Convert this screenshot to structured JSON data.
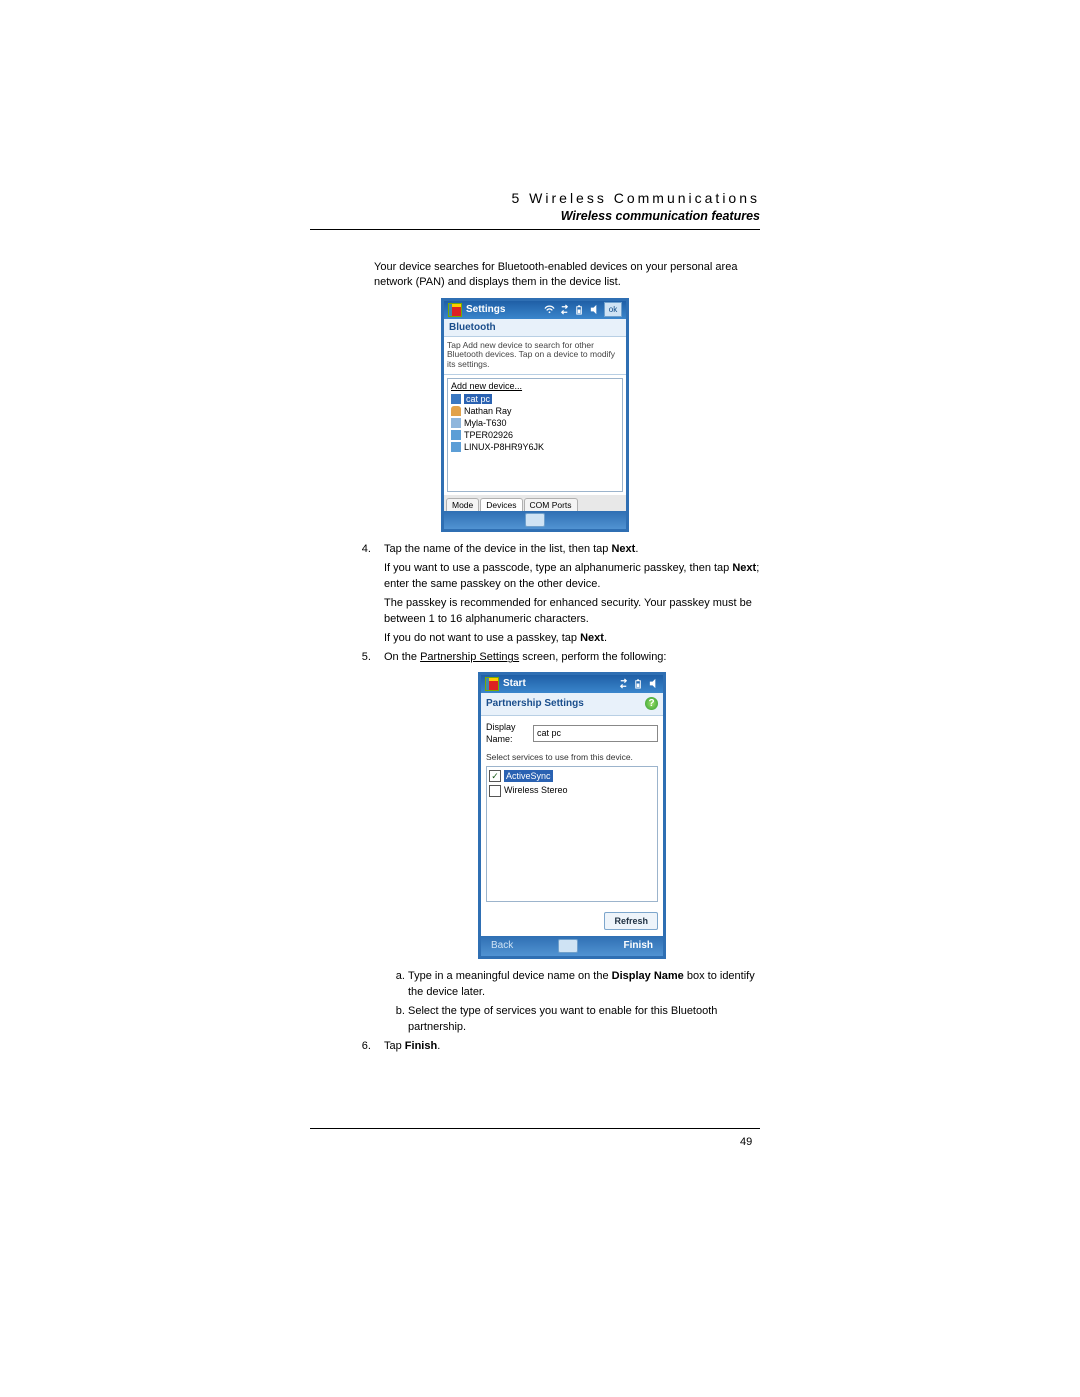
{
  "header": {
    "chapter": "5 Wireless Communications",
    "subtitle": "Wireless communication features"
  },
  "intro": "Your device searches for Bluetooth-enabled devices on your personal area network (PAN) and displays them in the device list.",
  "settings_shot": {
    "title": "Settings",
    "ok": "ok",
    "panel_title": "Bluetooth",
    "help_text": "Tap Add new device to search for other Bluetooth devices. Tap on a device to modify its settings.",
    "add_new": "Add new device...",
    "devices": [
      "cat pc",
      "Nathan Ray",
      "Myla-T630",
      "TPER02926",
      "LINUX-P8HR9Y6JK"
    ],
    "tabs": [
      "Mode",
      "Devices",
      "COM Ports"
    ]
  },
  "step4": {
    "line1_a": "Tap the name of the device in the list, then tap ",
    "line1_b": "Next",
    "line1_c": ".",
    "line2_a": "If you want to use a passcode, type an alphanumeric passkey, then tap ",
    "line2_b": "Next",
    "line2_c": "; enter the same passkey on the other device.",
    "line3": "The passkey is recommended for enhanced security. Your passkey must be between 1 to 16 alphanumeric characters.",
    "line4_a": "If you do not want to use a passkey, tap ",
    "line4_b": "Next",
    "line4_c": "."
  },
  "step5": {
    "text_a": "On the ",
    "text_link": "Partnership Settings",
    "text_b": " screen, perform the following:"
  },
  "partner_shot": {
    "title": "Start",
    "panel_title": "Partnership Settings",
    "display_label": "Display Name:",
    "display_value": "cat pc",
    "svc_label": "Select services to use from this device.",
    "services": [
      {
        "name": "ActiveSync",
        "checked": true,
        "hl": true
      },
      {
        "name": "Wireless Stereo",
        "checked": false,
        "hl": false
      }
    ],
    "refresh": "Refresh",
    "back": "Back",
    "finish": "Finish"
  },
  "sub_a": {
    "a": "Type in a meaningful device name on the ",
    "b": "Display Name",
    "c": " box to identify the device later."
  },
  "sub_b": "Select the type of services you want to enable for this Bluetooth partnership.",
  "step6": {
    "a": "Tap ",
    "b": "Finish",
    "c": "."
  },
  "page_number": "49"
}
